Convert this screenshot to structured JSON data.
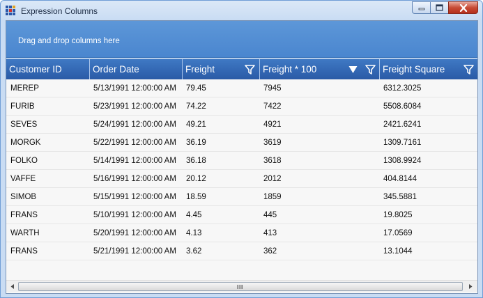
{
  "window": {
    "title": "Expression Columns",
    "icon": "grid-app-icon",
    "buttons": [
      "minimize-icon",
      "maximize-icon",
      "close-icon"
    ]
  },
  "grid": {
    "group_panel_text": "Drag and drop columns here",
    "columns": [
      {
        "label": "Customer ID",
        "filter": false,
        "sort_desc": false
      },
      {
        "label": "Order Date",
        "filter": false,
        "sort_desc": false
      },
      {
        "label": "Freight",
        "filter": true,
        "sort_desc": false
      },
      {
        "label": "Freight * 100",
        "filter": true,
        "sort_desc": true
      },
      {
        "label": "Freight Square",
        "filter": true,
        "sort_desc": false
      }
    ],
    "rows": [
      [
        "MEREP",
        "5/13/1991 12:00:00 AM",
        "79.45",
        "7945",
        "6312.3025"
      ],
      [
        "FURIB",
        "5/23/1991 12:00:00 AM",
        "74.22",
        "7422",
        "5508.6084"
      ],
      [
        "SEVES",
        "5/24/1991 12:00:00 AM",
        "49.21",
        "4921",
        "2421.6241"
      ],
      [
        "MORGK",
        "5/22/1991 12:00:00 AM",
        "36.19",
        "3619",
        "1309.7161"
      ],
      [
        "FOLKO",
        "5/14/1991 12:00:00 AM",
        "36.18",
        "3618",
        "1308.9924"
      ],
      [
        "VAFFE",
        "5/16/1991 12:00:00 AM",
        "20.12",
        "2012",
        "404.8144"
      ],
      [
        "SIMOB",
        "5/15/1991 12:00:00 AM",
        "18.59",
        "1859",
        "345.5881"
      ],
      [
        "FRANS",
        "5/10/1991 12:00:00 AM",
        "4.45",
        "445",
        "19.8025"
      ],
      [
        "WARTH",
        "5/20/1991 12:00:00 AM",
        "4.13",
        "413",
        "17.0569"
      ],
      [
        "FRANS",
        "5/21/1991 12:00:00 AM",
        "3.62",
        "362",
        "13.1044"
      ]
    ]
  },
  "scrollbar": {
    "left_icon": "scroll-left-icon",
    "right_icon": "scroll-right-icon",
    "grip_icon": "scroll-grip-icon"
  },
  "colors": {
    "header_bg": "#3366b4",
    "group_panel_bg": "#5592d6",
    "header_text": "#ffffff"
  }
}
